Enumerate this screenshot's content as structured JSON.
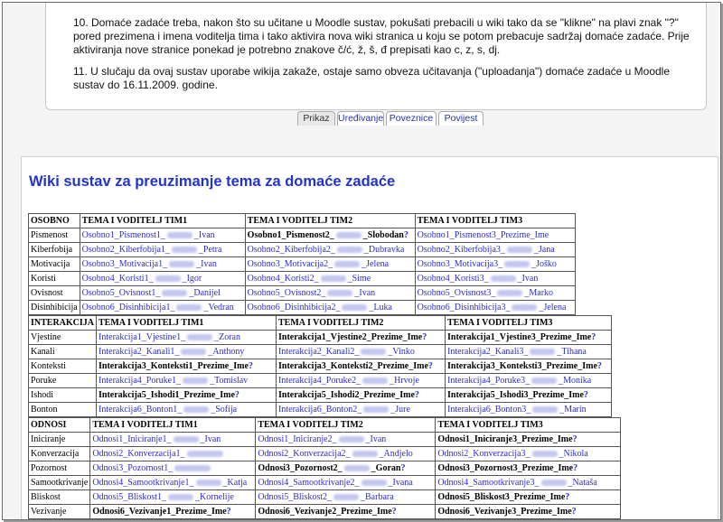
{
  "intro": {
    "item10": "10. Domaće zadaće treba, nakon što su učitane u Moodle sustav, pokušati prebacili u wiki tako da se \"klikne\" na plavi znak \"?\" pored prezimena i imena voditelja tima i tako aktivira nova wiki stranica u koju se potom prebacuje sadržaj domaće zadaće. Prije aktiviranja nove stranice ponekad je potrebno znakove č/ć, ž, š, đ prepisati kao c, z, s, dj.",
    "item11": "11. U slučaju da ovaj sustav uporabe wikija zakaže, ostaje samo obveza učitavanja (\"uploadanja\") domaće zadaće u Moodle sustav do 16.11.2009. godine."
  },
  "tabs": [
    "Prikaz",
    "Uređivanje",
    "Poveznice",
    "Povijest"
  ],
  "heading": "Wiki sustav za preuzimanje tema za domaće zadaće",
  "tables": [
    {
      "headers": [
        "OSOBNO",
        "TEMA I VODITELJ TIM1",
        "TEMA I VODITELJ TIM2",
        "TEMA I VODITELJ TIM3"
      ],
      "rows": [
        {
          "cat": "Pismenost",
          "cells": [
            {
              "text": "Osobno1_Pismenost1_",
              "tail": "_Ivan",
              "kind": "link"
            },
            {
              "text": "Osobno1_Pismenost2_",
              "tail": "_Slobodan",
              "kind": "new"
            },
            {
              "text": "Osobno1_Pismenost3_Prezime_Ime",
              "tail": "",
              "kind": "link"
            }
          ]
        },
        {
          "cat": "Kiberfobija",
          "cells": [
            {
              "text": "Osobno2_Kiberfobija1_",
              "tail": "_Petra",
              "kind": "link"
            },
            {
              "text": "Osobno2_Kiberfobija2_",
              "tail": "_Dubravka",
              "kind": "link"
            },
            {
              "text": "Osobno2_Kiberfobija3_",
              "tail": "_Jana",
              "kind": "link"
            }
          ]
        },
        {
          "cat": "Motivacija",
          "cells": [
            {
              "text": "Osobno3_Motivacija1_",
              "tail": "_Ivan",
              "kind": "link"
            },
            {
              "text": "Osobno3_Motivacija2_",
              "tail": "_Jelena",
              "kind": "link"
            },
            {
              "text": "Osobno3_Motivacija3_",
              "tail": "_Joško",
              "kind": "link"
            }
          ]
        },
        {
          "cat": "Koristi",
          "cells": [
            {
              "text": "Osobno4_Koristi1_",
              "tail": "_Igor",
              "kind": "link"
            },
            {
              "text": "Osobno4_Koristi2_",
              "tail": "_Sime",
              "kind": "link"
            },
            {
              "text": "Osobno4_Koristi3_",
              "tail": "_Ivan",
              "kind": "link"
            }
          ]
        },
        {
          "cat": "Ovisnost",
          "cells": [
            {
              "text": "Osobno5_Ovisnost1_",
              "tail": "_Danijel",
              "kind": "link"
            },
            {
              "text": "Osobno5_Ovisnost2_",
              "tail": "_Ivan",
              "kind": "link"
            },
            {
              "text": "Osobno5_Ovisnost3_",
              "tail": "_Marko",
              "kind": "link"
            }
          ]
        },
        {
          "cat": "Disinhibicija",
          "cells": [
            {
              "text": "Osobno6_Disinhibicija1_",
              "tail": "_Vedran",
              "kind": "link"
            },
            {
              "text": "Osobno6_Disinhibicija2_",
              "tail": "_Luka",
              "kind": "link"
            },
            {
              "text": "Osobno6_Disinhibicija3_",
              "tail": "_Jelena",
              "kind": "link"
            }
          ]
        }
      ]
    },
    {
      "headers": [
        "INTERAKCIJA",
        "TEMA I VODITELJ TIM1",
        "TEMA I VODITELJ TIM2",
        "TEMA I VODITELJ TIM3"
      ],
      "rows": [
        {
          "cat": "Vjestine",
          "cells": [
            {
              "text": "Interakcija1_Vjestine1_",
              "tail": "_Zoran",
              "kind": "link"
            },
            {
              "text": "Interakcija1_Vjestine2_Prezime_Ime",
              "tail": "",
              "kind": "new"
            },
            {
              "text": "Interakcija1_Vjestine3_Prezime_Ime",
              "tail": "",
              "kind": "new"
            }
          ]
        },
        {
          "cat": "Kanali",
          "cells": [
            {
              "text": "Interakcija2_Kanali1_",
              "tail": "_Anthony",
              "kind": "link"
            },
            {
              "text": "Interakcija2_Kanali2_",
              "tail": "_Vinko",
              "kind": "link"
            },
            {
              "text": "Interakcija2_Kanali3_",
              "tail": "_Tihana",
              "kind": "link"
            }
          ]
        },
        {
          "cat": "Konteksti",
          "cells": [
            {
              "text": "Interakcija3_Konteksti1_Prezime_Ime",
              "tail": "",
              "kind": "new"
            },
            {
              "text": "Interakcija3_Konteksti2_Prezime_Ime",
              "tail": "",
              "kind": "new"
            },
            {
              "text": "Interakcija3_Konteksti3_Prezime_Ime",
              "tail": "",
              "kind": "new"
            }
          ]
        },
        {
          "cat": "Poruke",
          "cells": [
            {
              "text": "Interakcija4_Poruke1_",
              "tail": "_Tomislav",
              "kind": "link"
            },
            {
              "text": "Interakcija4_Poruke2_",
              "tail": "_Hrvoje",
              "kind": "link"
            },
            {
              "text": "Interakcija4_Poruke3_",
              "tail": "_Monika",
              "kind": "link"
            }
          ]
        },
        {
          "cat": "Ishodi",
          "cells": [
            {
              "text": "Interakcija5_Ishodi1_Prezime_Ime",
              "tail": "",
              "kind": "new"
            },
            {
              "text": "Interakcija5_Ishodi2_Prezime_Ime",
              "tail": "",
              "kind": "new"
            },
            {
              "text": "Interakcija5_Ishodi3_Prezime_Ime",
              "tail": "",
              "kind": "new"
            }
          ]
        },
        {
          "cat": "Bonton",
          "cells": [
            {
              "text": "Interakcija6_Bonton1_",
              "tail": "_Sofija",
              "kind": "link"
            },
            {
              "text": "Interakcija6_Bonton2_",
              "tail": "_Jure",
              "kind": "link"
            },
            {
              "text": "Interakcija6_Bonton3_",
              "tail": "_Marin",
              "kind": "link"
            }
          ]
        }
      ]
    },
    {
      "headers": [
        "ODNOSI",
        "TEMA I VODITELJ TIM1",
        "TEMA I VODITELJ TIM2",
        "TEMA I VODITELJ TIM3"
      ],
      "rows": [
        {
          "cat": "Iniciranje",
          "cells": [
            {
              "text": "Odnosi1_Iniciranje1_",
              "tail": "_Ivan",
              "kind": "link"
            },
            {
              "text": "Odnosi1_Iniciranje2_",
              "tail": "_Ivan",
              "kind": "link"
            },
            {
              "text": "Odnosi1_Iniciranje3_Prezime_Ime",
              "tail": "",
              "kind": "new"
            }
          ]
        },
        {
          "cat": "Konverzacija",
          "cells": [
            {
              "text": "Odnosi2_Konverzacija1_",
              "tail": "",
              "kind": "link"
            },
            {
              "text": "Odnosi2_Konverzacija2_",
              "tail": "_Andjelo",
              "kind": "link"
            },
            {
              "text": "Odnosi2_Konverzacija3_",
              "tail": "_Nikola",
              "kind": "link"
            }
          ]
        },
        {
          "cat": "Pozornost",
          "cells": [
            {
              "text": "Odnosi3_Pozornost1_",
              "tail": "",
              "kind": "link"
            },
            {
              "text": "Odnosi3_Pozornost2_",
              "tail": "_Goran",
              "kind": "new"
            },
            {
              "text": "Odnosi3_Pozornost3_Prezime_Ime",
              "tail": "",
              "kind": "new"
            }
          ]
        },
        {
          "cat": "Samootkrivanje",
          "cells": [
            {
              "text": "Odnosi4_Samootkrivanje1_",
              "tail": "_Katja",
              "kind": "link"
            },
            {
              "text": "Odnosi4_Samootkrivanje2_",
              "tail": "_Ivana",
              "kind": "link"
            },
            {
              "text": "Odnosi4_Samootkrivanje3_",
              "tail": "_Nataša",
              "kind": "link"
            }
          ]
        },
        {
          "cat": "Bliskost",
          "cells": [
            {
              "text": "Odnosi5_Bliskost1_",
              "tail": "_Kornelije",
              "kind": "link"
            },
            {
              "text": "Odnosi5_Bliskost2_",
              "tail": "_Barbara",
              "kind": "link"
            },
            {
              "text": "Odnosi5_Bliskost3_Prezime_Ime",
              "tail": "",
              "kind": "new"
            }
          ]
        },
        {
          "cat": "Vezivanje",
          "cells": [
            {
              "text": "Odnosi6_Vezivanje1_Prezime_Ime",
              "tail": "",
              "kind": "new"
            },
            {
              "text": "Odnosi6_Vezivanje2_Prezime_Ime",
              "tail": "",
              "kind": "new"
            },
            {
              "text": "Odnosi6_Vezivanje3_Prezime_Ime",
              "tail": "",
              "kind": "new"
            }
          ]
        }
      ]
    }
  ],
  "colors": {
    "link": "#2b2bd9",
    "heading": "#2233cc"
  }
}
